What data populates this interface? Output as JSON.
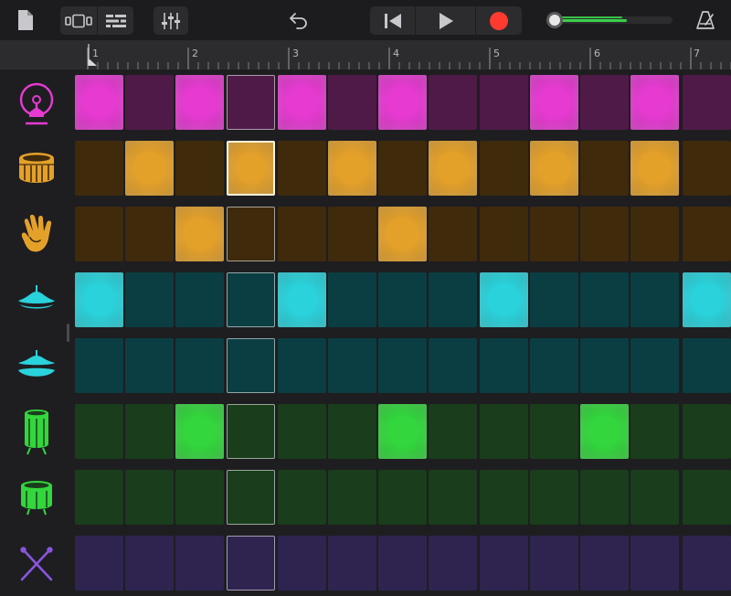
{
  "toolbar": {
    "buttons": [
      {
        "name": "my-songs-button",
        "icon": "document-icon"
      },
      {
        "name": "view-toggle-button",
        "icon": "view-toggle-icon"
      },
      {
        "name": "tracks-view-button",
        "icon": "tracks-icon"
      },
      {
        "name": "mixer-button",
        "icon": "sliders-icon"
      },
      {
        "name": "undo-button",
        "icon": "undo-icon"
      },
      {
        "name": "go-to-beginning-button",
        "icon": "skip-back-icon"
      },
      {
        "name": "play-button",
        "icon": "play-icon"
      },
      {
        "name": "record-button",
        "icon": "record-icon"
      },
      {
        "name": "metronome-button",
        "icon": "metronome-icon"
      }
    ],
    "master_volume": 0.63
  },
  "ruler": {
    "bar_numbers": [
      "1",
      "2",
      "3",
      "4",
      "5",
      "6",
      "7"
    ]
  },
  "colors": {
    "magenta_on": "#e63ad1",
    "magenta_off": "#4f1a48",
    "orange_on": "#e4a12a",
    "orange_off": "#3f2a0c",
    "cyan_on": "#2ad2db",
    "cyan_off": "#0b3e42",
    "green_on": "#33d63d",
    "green_off": "#1a3d1c",
    "purple_on": "#8a55e0",
    "purple_off": "#2f2450",
    "record": "#ff3b30",
    "accent_green": "#3ad04a"
  },
  "rows": [
    {
      "instrument": "kick-drum",
      "icon": "kick-drum-icon",
      "color": "magenta",
      "steps": [
        1,
        0,
        1,
        0,
        1,
        0,
        1,
        0,
        0,
        1,
        0,
        1,
        0
      ]
    },
    {
      "instrument": "snare",
      "icon": "snare-drum-icon",
      "color": "orange",
      "steps": [
        0,
        1,
        0,
        1,
        0,
        1,
        0,
        1,
        0,
        1,
        0,
        1,
        0
      ]
    },
    {
      "instrument": "clap",
      "icon": "hand-clap-icon",
      "color": "orange",
      "steps": [
        0,
        0,
        1,
        0,
        0,
        0,
        1,
        0,
        0,
        0,
        0,
        0,
        0
      ]
    },
    {
      "instrument": "closed-hi-hat",
      "icon": "hi-hat-closed-icon",
      "color": "cyan",
      "steps": [
        1,
        0,
        0,
        0,
        1,
        0,
        0,
        0,
        1,
        0,
        0,
        0,
        1
      ]
    },
    {
      "instrument": "open-hi-hat",
      "icon": "hi-hat-open-icon",
      "color": "cyan",
      "steps": [
        0,
        0,
        0,
        0,
        0,
        0,
        0,
        0,
        0,
        0,
        0,
        0,
        0
      ]
    },
    {
      "instrument": "tom-high",
      "icon": "tall-drum-icon",
      "color": "green",
      "steps": [
        0,
        0,
        1,
        0,
        0,
        0,
        1,
        0,
        0,
        0,
        1,
        0,
        0
      ]
    },
    {
      "instrument": "tom-low",
      "icon": "floor-tom-icon",
      "color": "green",
      "steps": [
        0,
        0,
        0,
        0,
        0,
        0,
        0,
        0,
        0,
        0,
        0,
        0,
        0
      ]
    },
    {
      "instrument": "sticks",
      "icon": "crossed-sticks-icon",
      "color": "purple",
      "steps": [
        0,
        0,
        0,
        0,
        0,
        0,
        0,
        0,
        0,
        0,
        0,
        0,
        0
      ]
    }
  ],
  "selected_step_column": 3
}
